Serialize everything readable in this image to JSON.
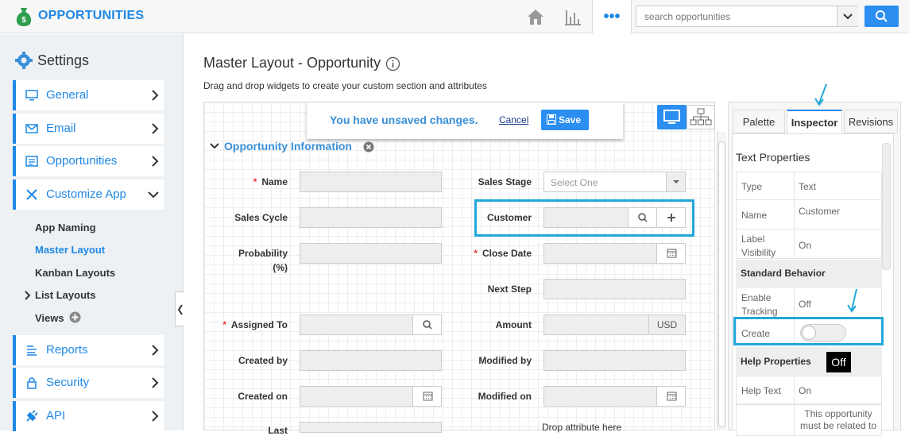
{
  "header": {
    "app_title": "OPPORTUNITIES",
    "icons": [
      "money-bag-icon",
      "home-icon",
      "reports-icon",
      "more-icon",
      "search-icon"
    ],
    "more_label": "•••",
    "search_placeholder": "search opportunities"
  },
  "sidebar": {
    "title": "Settings",
    "items": [
      {
        "label": "General",
        "icon": "monitor-icon"
      },
      {
        "label": "Email",
        "icon": "envelope-icon"
      },
      {
        "label": "Opportunities",
        "icon": "list-icon"
      },
      {
        "label": "Customize App",
        "icon": "tools-icon",
        "expanded": true
      },
      {
        "label": "Reports",
        "icon": "report-icon"
      },
      {
        "label": "Security",
        "icon": "lock-icon"
      },
      {
        "label": "API",
        "icon": "plug-icon"
      }
    ],
    "subitems": [
      "App Naming",
      "Master Layout",
      "Kanban Layouts",
      "List Layouts",
      "Views"
    ],
    "active_subitem": "Master Layout"
  },
  "main": {
    "title": "Master Layout - Opportunity",
    "description": "Drag and drop widgets to create your custom section and attributes",
    "unsaved_text": "You have unsaved changes.",
    "cancel_label": "Cancel",
    "save_label": "Save",
    "section_title": "Opportunity Information",
    "fields": {
      "name": "Name",
      "sales_stage": "Sales Stage",
      "sales_stage_value": "Select One",
      "sales_cycle": "Sales Cycle",
      "customer": "Customer",
      "probability": "Probability",
      "probability_unit": "(%)",
      "close_date": "Close Date",
      "next_step": "Next Step",
      "assigned_to": "Assigned To",
      "amount": "Amount",
      "amount_currency": "USD",
      "created_by": "Created by",
      "modified_by": "Modified by",
      "created_on": "Created on",
      "modified_on": "Modified on",
      "last": "Last",
      "drop_hint": "Drop attribute here"
    }
  },
  "inspector": {
    "tabs": [
      "Palette",
      "Inspector",
      "Revisions"
    ],
    "active_tab": "Inspector",
    "section_title": "Text Properties",
    "rows": [
      {
        "key": "Type",
        "value": "Text"
      },
      {
        "key": "Name",
        "value": "Customer"
      },
      {
        "key": "Label Visibility",
        "value": "On"
      }
    ],
    "standard_behavior": "Standard Behavior",
    "behavior_rows": [
      {
        "key": "Enable Tracking",
        "value": "Off"
      },
      {
        "key": "Create",
        "value": "off"
      }
    ],
    "help_properties": "Help Properties",
    "tooltip": "Off",
    "help_rows": [
      {
        "key": "Help Text",
        "value": "On"
      },
      {
        "key": "",
        "value": "This opportunity must be related to"
      }
    ]
  },
  "colors": {
    "accent": "#1e88e5",
    "highlight": "#22a7d9",
    "required": "#e53935"
  }
}
